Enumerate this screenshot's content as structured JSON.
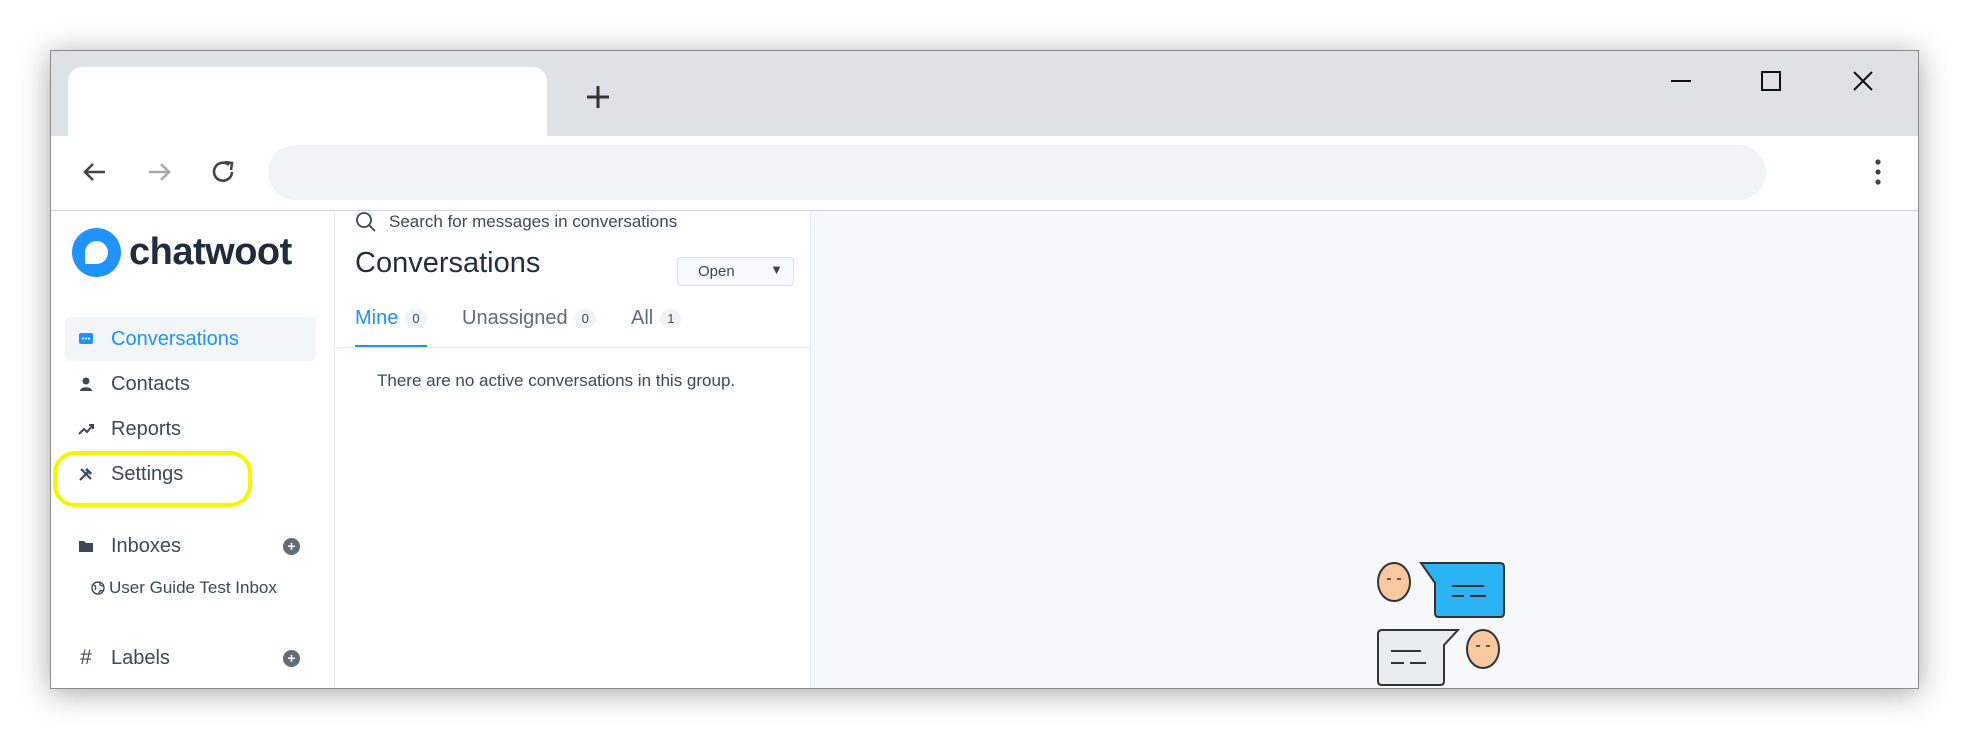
{
  "browser": {
    "new_tab_icon": "plus-icon",
    "window_controls": [
      "minimize-icon",
      "maximize-icon",
      "close-icon"
    ],
    "nav_icons": [
      "back-arrow-icon",
      "forward-arrow-icon",
      "reload-icon"
    ],
    "menu_icon": "kebab-menu-icon"
  },
  "brand": {
    "name": "chatwoot",
    "color": "#1f93ff"
  },
  "sidebar": {
    "nav": [
      {
        "label": "Conversations",
        "icon": "chat-bubble-icon",
        "active": true
      },
      {
        "label": "Contacts",
        "icon": "person-icon",
        "active": false
      },
      {
        "label": "Reports",
        "icon": "trend-chart-icon",
        "active": false
      },
      {
        "label": "Settings",
        "icon": "tools-icon",
        "active": false,
        "highlighted": true
      }
    ],
    "inboxes": {
      "label": "Inboxes",
      "icon": "folder-icon",
      "add_icon": "add-circle-icon",
      "items": [
        {
          "label": "User Guide Test Inbox",
          "icon": "globe-icon"
        }
      ]
    },
    "labels": {
      "label": "Labels",
      "icon": "hash-icon",
      "add_icon": "add-circle-icon"
    }
  },
  "conversations": {
    "search_placeholder": "Search for messages in conversations",
    "title": "Conversations",
    "status_filter": "Open",
    "tabs": [
      {
        "label": "Mine",
        "count": "0",
        "active": true
      },
      {
        "label": "Unassigned",
        "count": "0",
        "active": false
      },
      {
        "label": "All",
        "count": "1",
        "active": false
      }
    ],
    "empty_message": "There are no active conversations in this group."
  },
  "main": {
    "illustration": "chat-people-illustration"
  },
  "colors": {
    "accent": "#1f93ff",
    "highlight": "#f5f500",
    "bubble": "#2bb3f3",
    "face": "#f8c9a0"
  }
}
